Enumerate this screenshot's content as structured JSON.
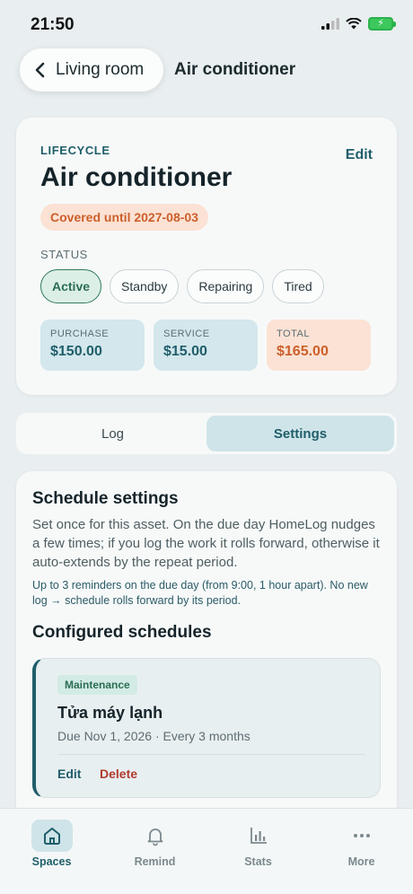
{
  "status_bar": {
    "time": "21:50"
  },
  "header": {
    "back_label": "Living room",
    "title": "Air conditioner"
  },
  "lifecycle": {
    "section_label": "LIFECYCLE",
    "edit_label": "Edit",
    "asset_name": "Air conditioner",
    "coverage": "Covered until 2027-08-03",
    "status_label": "STATUS",
    "statuses": [
      "Active",
      "Standby",
      "Repairing",
      "Tired"
    ],
    "selected_status": "Active",
    "costs": [
      {
        "label": "PURCHASE",
        "value": "$150.00"
      },
      {
        "label": "SERVICE",
        "value": "$15.00"
      },
      {
        "label": "TOTAL",
        "value": "$165.00"
      }
    ]
  },
  "tabs": [
    {
      "label": "Log",
      "selected": false
    },
    {
      "label": "Settings",
      "selected": true
    }
  ],
  "schedule": {
    "title": "Schedule settings",
    "description": "Set once for this asset. On the due day HomeLog nudges a few times; if you log the work it rolls forward, otherwise it auto-extends by the repeat period.",
    "note": "Up to 3 reminders on the due day (from 9:00, 1 hour apart). No new log → schedule rolls forward by its period.",
    "configured_title": "Configured schedules",
    "items": [
      {
        "tag": "Maintenance",
        "name": "Tửa máy lạnh",
        "meta": "Due Nov 1, 2026 · Every 3 months",
        "edit_label": "Edit",
        "delete_label": "Delete"
      }
    ]
  },
  "bottom_nav": [
    {
      "label": "Spaces",
      "icon": "home-icon",
      "active": true
    },
    {
      "label": "Remind",
      "icon": "bell-icon",
      "active": false
    },
    {
      "label": "Stats",
      "icon": "bar-chart-icon",
      "active": false
    },
    {
      "label": "More",
      "icon": "more-dots-icon",
      "active": false
    }
  ],
  "colors": {
    "accent": "#1f5e6a",
    "active_green": "#2b6e53",
    "warning_orange": "#cc5f2b",
    "danger_red": "#b23b2e"
  }
}
